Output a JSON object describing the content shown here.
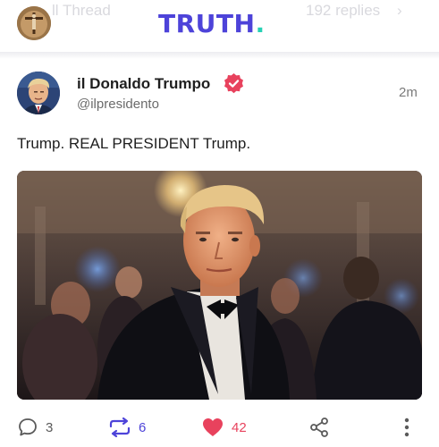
{
  "header": {
    "brand_text": "TRUTH",
    "brand_dot": ".",
    "ghost_left_text": "ll Thread",
    "ghost_right_text": "192 replies",
    "brand_color": "#4d43d9",
    "accent_color": "#27d1b5"
  },
  "post": {
    "display_name": "il Donaldo Trumpo",
    "handle": "@ilpresidento",
    "timestamp": "2m",
    "text": "Trump. REAL PRESIDENT Trump.",
    "verified_color": "#e8425d"
  },
  "actions": {
    "reply_count": "3",
    "retruth_count": "6",
    "like_count": "42",
    "retruth_color": "#4d43d9",
    "like_color": "#e8425d"
  },
  "icons": {
    "reply": "speech-bubble-icon",
    "retruth": "repost-arrows-icon",
    "like": "heart-icon",
    "share": "share-nodes-icon",
    "more": "vertical-dots-icon"
  }
}
